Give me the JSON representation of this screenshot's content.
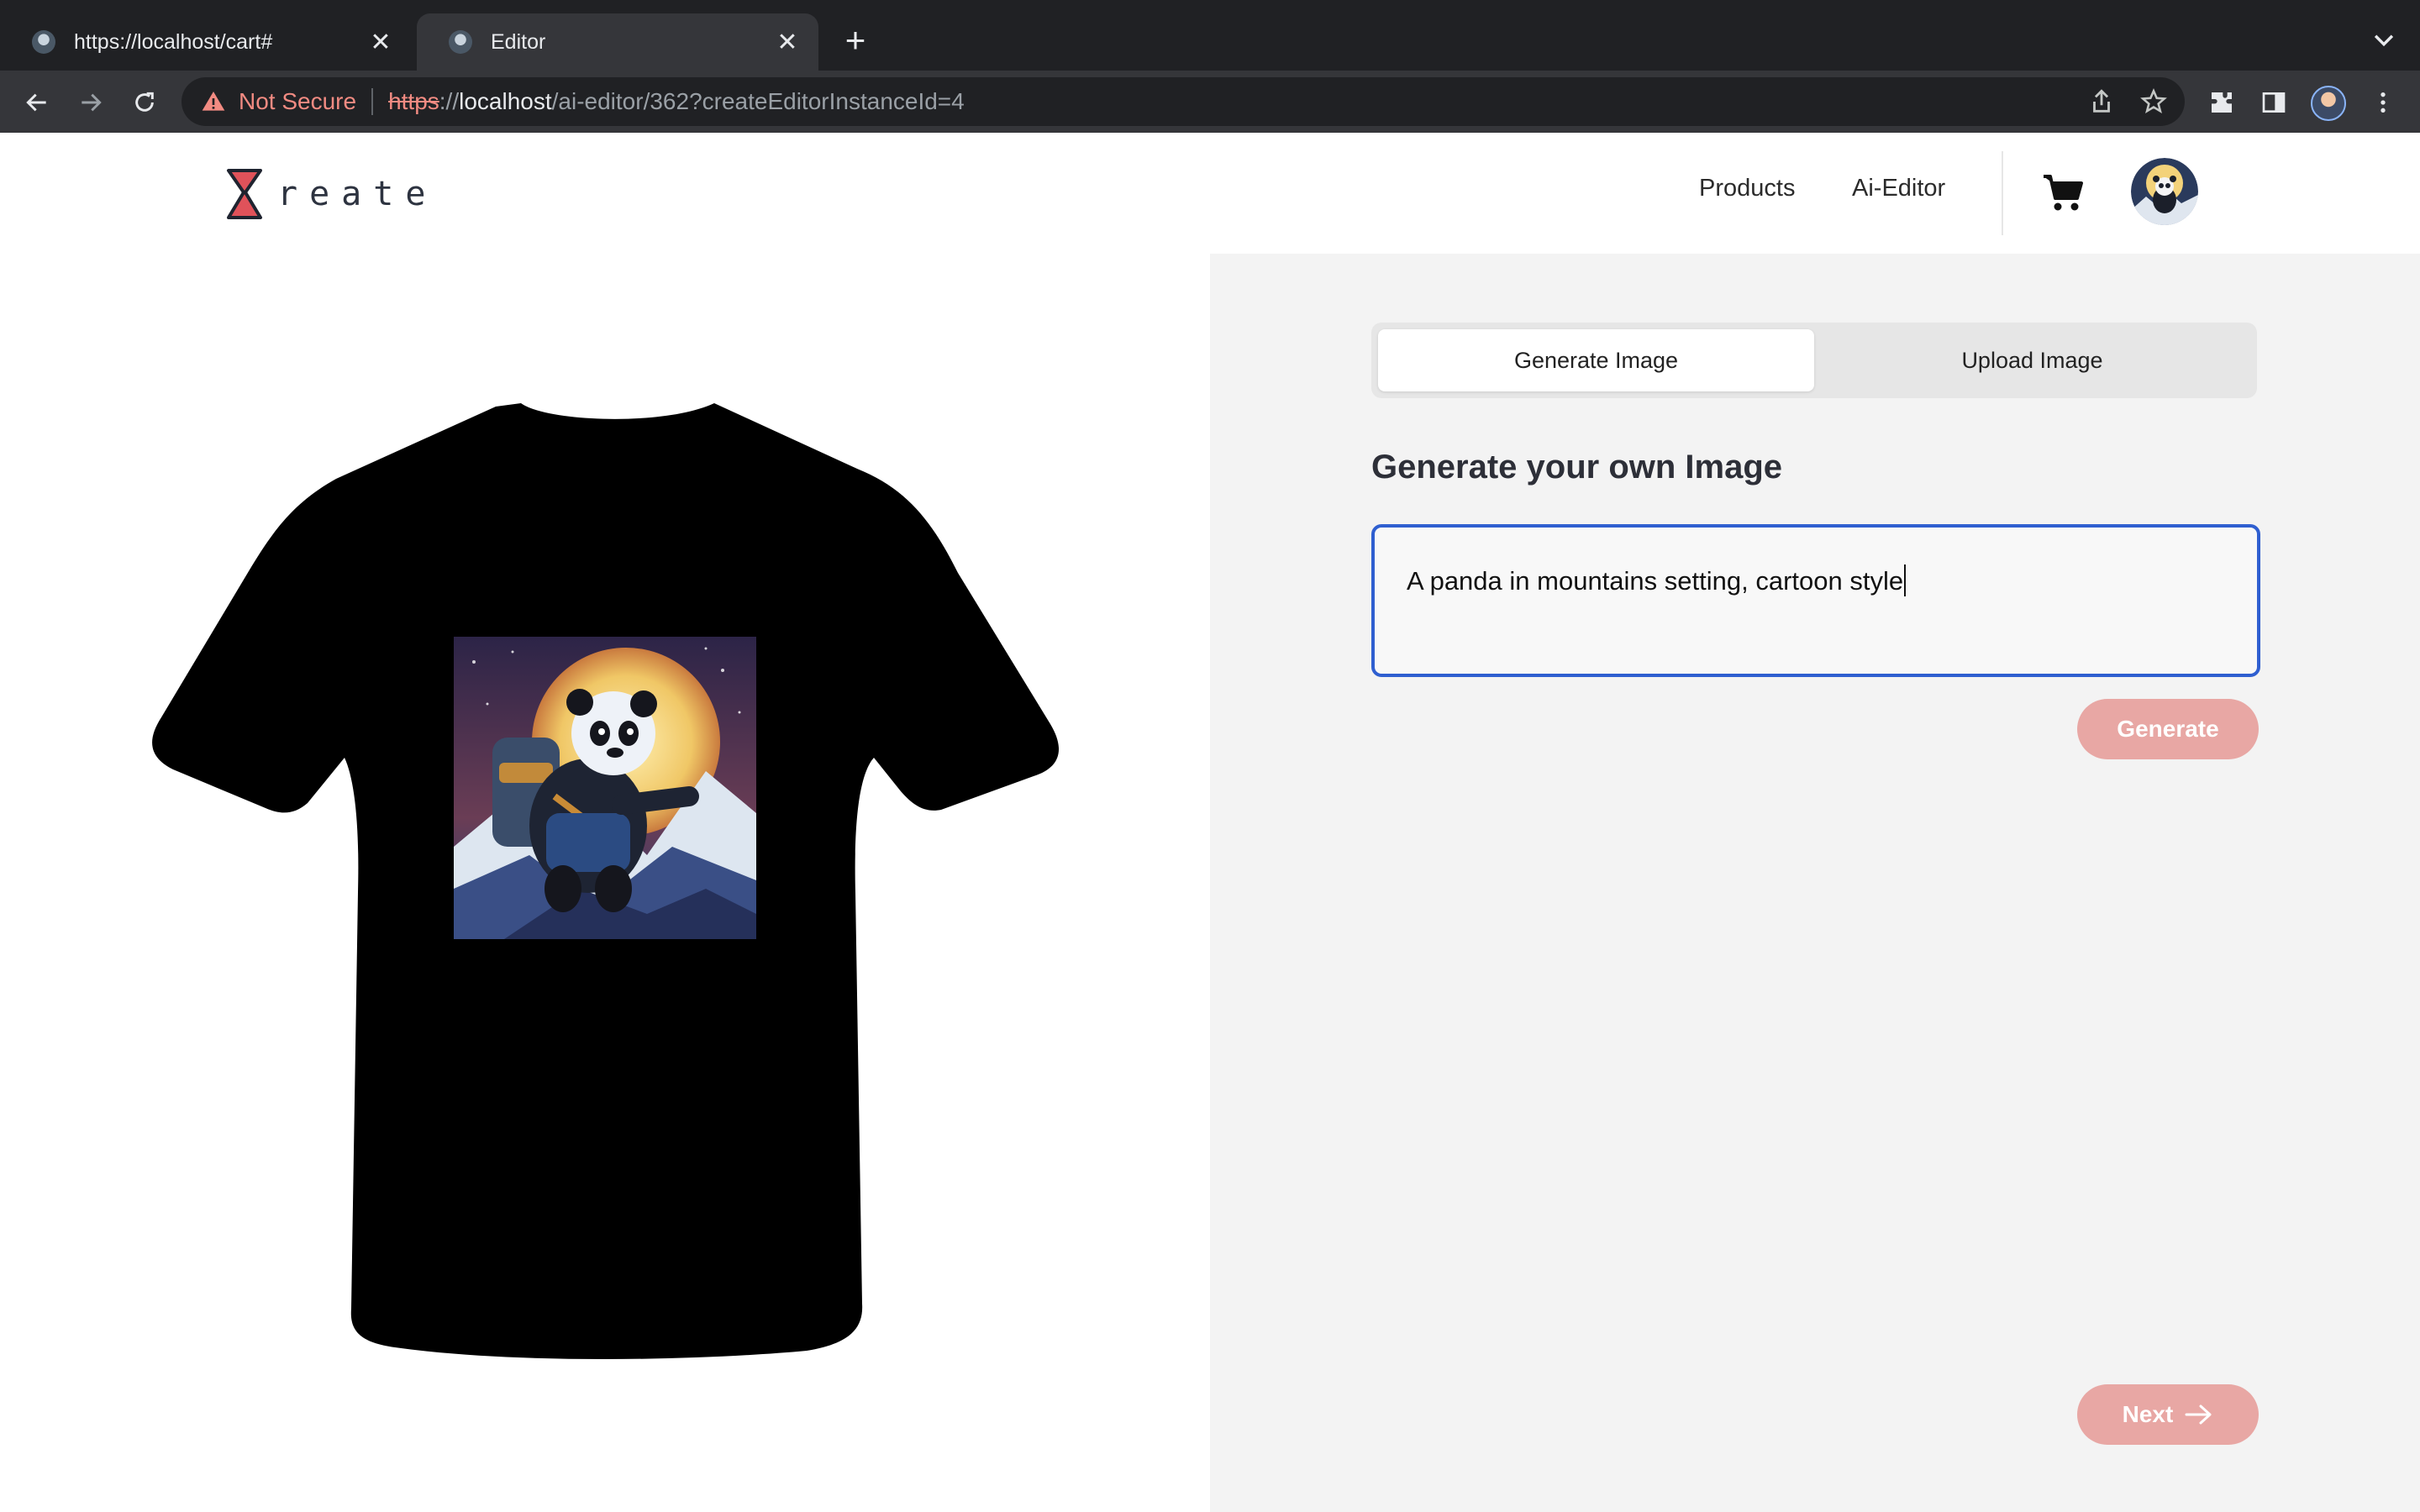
{
  "browser": {
    "tabs": [
      {
        "title": "https://localhost/cart#",
        "active": false,
        "icon": "panda-favicon-icon"
      },
      {
        "title": "Editor",
        "active": true,
        "icon": "panda-favicon-icon"
      }
    ],
    "security_label": "Not Secure",
    "url": {
      "scheme": "https",
      "separator": "://",
      "host": "localhost",
      "path": "/ai-editor/362?createEditorInstanceId=4"
    }
  },
  "header": {
    "logo_text": "reate",
    "nav": [
      {
        "label": "Products"
      },
      {
        "label": "Ai-Editor"
      }
    ],
    "icons": [
      "cart-icon",
      "user-avatar"
    ]
  },
  "preview": {
    "garment": "black t-shirt",
    "design": "panda hiker with moon and mountains"
  },
  "editor": {
    "tabs": [
      {
        "label": "Generate Image",
        "active": true
      },
      {
        "label": "Upload Image",
        "active": false
      }
    ],
    "heading": "Generate your own Image",
    "prompt_value": "A panda in mountains setting, cartoon style",
    "generate_label": "Generate",
    "next_label": "Next"
  },
  "colors": {
    "primary_button": "#e8a7a4",
    "focus_border": "#2f5fd0",
    "logo_red": "#e0525a",
    "panel_bg": "#f3f3f3"
  }
}
